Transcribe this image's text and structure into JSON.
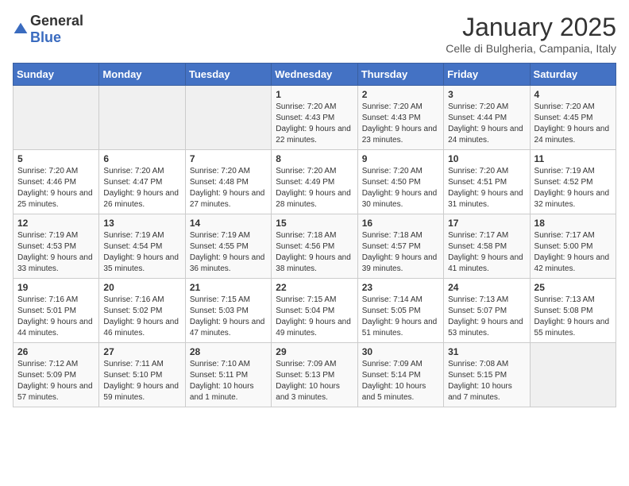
{
  "header": {
    "logo": {
      "general": "General",
      "blue": "Blue"
    },
    "title": "January 2025",
    "location": "Celle di Bulgheria, Campania, Italy"
  },
  "days_header": [
    "Sunday",
    "Monday",
    "Tuesday",
    "Wednesday",
    "Thursday",
    "Friday",
    "Saturday"
  ],
  "weeks": [
    [
      {
        "day": "",
        "empty": true
      },
      {
        "day": "",
        "empty": true
      },
      {
        "day": "",
        "empty": true
      },
      {
        "day": "1",
        "sunrise": "7:20 AM",
        "sunset": "4:43 PM",
        "daylight": "9 hours and 22 minutes."
      },
      {
        "day": "2",
        "sunrise": "7:20 AM",
        "sunset": "4:43 PM",
        "daylight": "9 hours and 23 minutes."
      },
      {
        "day": "3",
        "sunrise": "7:20 AM",
        "sunset": "4:44 PM",
        "daylight": "9 hours and 24 minutes."
      },
      {
        "day": "4",
        "sunrise": "7:20 AM",
        "sunset": "4:45 PM",
        "daylight": "9 hours and 24 minutes."
      }
    ],
    [
      {
        "day": "5",
        "sunrise": "7:20 AM",
        "sunset": "4:46 PM",
        "daylight": "9 hours and 25 minutes."
      },
      {
        "day": "6",
        "sunrise": "7:20 AM",
        "sunset": "4:47 PM",
        "daylight": "9 hours and 26 minutes."
      },
      {
        "day": "7",
        "sunrise": "7:20 AM",
        "sunset": "4:48 PM",
        "daylight": "9 hours and 27 minutes."
      },
      {
        "day": "8",
        "sunrise": "7:20 AM",
        "sunset": "4:49 PM",
        "daylight": "9 hours and 28 minutes."
      },
      {
        "day": "9",
        "sunrise": "7:20 AM",
        "sunset": "4:50 PM",
        "daylight": "9 hours and 30 minutes."
      },
      {
        "day": "10",
        "sunrise": "7:20 AM",
        "sunset": "4:51 PM",
        "daylight": "9 hours and 31 minutes."
      },
      {
        "day": "11",
        "sunrise": "7:19 AM",
        "sunset": "4:52 PM",
        "daylight": "9 hours and 32 minutes."
      }
    ],
    [
      {
        "day": "12",
        "sunrise": "7:19 AM",
        "sunset": "4:53 PM",
        "daylight": "9 hours and 33 minutes."
      },
      {
        "day": "13",
        "sunrise": "7:19 AM",
        "sunset": "4:54 PM",
        "daylight": "9 hours and 35 minutes."
      },
      {
        "day": "14",
        "sunrise": "7:19 AM",
        "sunset": "4:55 PM",
        "daylight": "9 hours and 36 minutes."
      },
      {
        "day": "15",
        "sunrise": "7:18 AM",
        "sunset": "4:56 PM",
        "daylight": "9 hours and 38 minutes."
      },
      {
        "day": "16",
        "sunrise": "7:18 AM",
        "sunset": "4:57 PM",
        "daylight": "9 hours and 39 minutes."
      },
      {
        "day": "17",
        "sunrise": "7:17 AM",
        "sunset": "4:58 PM",
        "daylight": "9 hours and 41 minutes."
      },
      {
        "day": "18",
        "sunrise": "7:17 AM",
        "sunset": "5:00 PM",
        "daylight": "9 hours and 42 minutes."
      }
    ],
    [
      {
        "day": "19",
        "sunrise": "7:16 AM",
        "sunset": "5:01 PM",
        "daylight": "9 hours and 44 minutes."
      },
      {
        "day": "20",
        "sunrise": "7:16 AM",
        "sunset": "5:02 PM",
        "daylight": "9 hours and 46 minutes."
      },
      {
        "day": "21",
        "sunrise": "7:15 AM",
        "sunset": "5:03 PM",
        "daylight": "9 hours and 47 minutes."
      },
      {
        "day": "22",
        "sunrise": "7:15 AM",
        "sunset": "5:04 PM",
        "daylight": "9 hours and 49 minutes."
      },
      {
        "day": "23",
        "sunrise": "7:14 AM",
        "sunset": "5:05 PM",
        "daylight": "9 hours and 51 minutes."
      },
      {
        "day": "24",
        "sunrise": "7:13 AM",
        "sunset": "5:07 PM",
        "daylight": "9 hours and 53 minutes."
      },
      {
        "day": "25",
        "sunrise": "7:13 AM",
        "sunset": "5:08 PM",
        "daylight": "9 hours and 55 minutes."
      }
    ],
    [
      {
        "day": "26",
        "sunrise": "7:12 AM",
        "sunset": "5:09 PM",
        "daylight": "9 hours and 57 minutes."
      },
      {
        "day": "27",
        "sunrise": "7:11 AM",
        "sunset": "5:10 PM",
        "daylight": "9 hours and 59 minutes."
      },
      {
        "day": "28",
        "sunrise": "7:10 AM",
        "sunset": "5:11 PM",
        "daylight": "10 hours and 1 minute."
      },
      {
        "day": "29",
        "sunrise": "7:09 AM",
        "sunset": "5:13 PM",
        "daylight": "10 hours and 3 minutes."
      },
      {
        "day": "30",
        "sunrise": "7:09 AM",
        "sunset": "5:14 PM",
        "daylight": "10 hours and 5 minutes."
      },
      {
        "day": "31",
        "sunrise": "7:08 AM",
        "sunset": "5:15 PM",
        "daylight": "10 hours and 7 minutes."
      },
      {
        "day": "",
        "empty": true
      }
    ]
  ]
}
